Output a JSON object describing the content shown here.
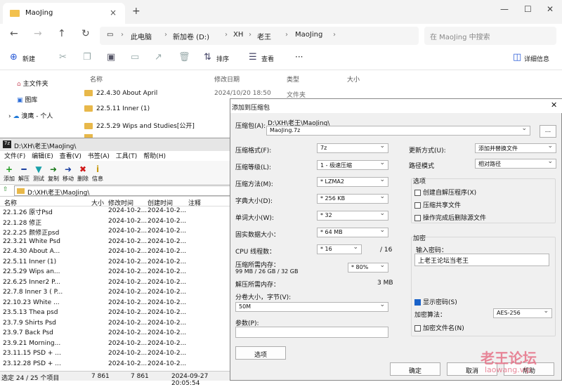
{
  "explorer": {
    "tab_title": "MaoJing",
    "breadcrumbs": [
      "此电脑",
      "新加卷 (D:)",
      "XH",
      "老王",
      "MaoJing"
    ],
    "search_placeholder": "在 MaoJing 中搜索",
    "toolbar": {
      "new": "新建",
      "sort": "排序",
      "view": "查看",
      "more": "···",
      "details": "详细信息"
    },
    "nav": [
      "主文件夹",
      "图库",
      "溴鹰 - 个人"
    ],
    "columns": {
      "name": "名称",
      "date": "修改日期",
      "type": "类型",
      "size": "大小"
    },
    "rows": [
      {
        "name": "22.4.30 About April",
        "date": "2024/10/20 18:50",
        "type": "文件夹"
      },
      {
        "name": "22.5.11 Inner (1)",
        "date": "",
        "type": ""
      },
      {
        "name": "22.5.29 Wips and Studies[公开]",
        "date": "",
        "type": ""
      }
    ]
  },
  "fm": {
    "title": "D:\\XH\\老王\\MaoJing\\",
    "menu": [
      "文件(F)",
      "编辑(E)",
      "查看(V)",
      "书签(A)",
      "工具(T)",
      "帮助(H)"
    ],
    "tools": [
      {
        "label": "添加",
        "icon": "+",
        "color": "#1c9a1c"
      },
      {
        "label": "解压",
        "icon": "━",
        "color": "#1a3fa0"
      },
      {
        "label": "测试",
        "icon": "▼",
        "color": "#18a0a8"
      },
      {
        "label": "复制",
        "icon": "➜",
        "color": "#1a7a1a"
      },
      {
        "label": "移动",
        "icon": "➜",
        "color": "#1a3fa0"
      },
      {
        "label": "删除",
        "icon": "✖",
        "color": "#d01818"
      },
      {
        "label": "信息",
        "icon": "i",
        "color": "#c89a10"
      }
    ],
    "path": "D:\\XH\\老王\\MaoJing\\",
    "columns": {
      "name": "名称",
      "size": "大小",
      "modified": "修改时间",
      "created": "创建时间",
      "comment": "注释"
    },
    "rows": [
      {
        "name": "22.1.26 原寸Psd",
        "modified": "2024-10-2...",
        "created": "2024-10-2..."
      },
      {
        "name": "22.1.28 修正",
        "modified": "2024-10-2...",
        "created": "2024-10-2..."
      },
      {
        "name": "22.2.25 颜修正psd",
        "modified": "2024-10-2...",
        "created": "2024-10-2..."
      },
      {
        "name": "22.3.21 White Psd",
        "modified": "2024-10-2...",
        "created": "2024-10-2..."
      },
      {
        "name": "22.4.30 About A...",
        "modified": "2024-10-2...",
        "created": "2024-10-2..."
      },
      {
        "name": "22.5.11 Inner (1)",
        "modified": "2024-10-2...",
        "created": "2024-10-2..."
      },
      {
        "name": "22.5.29 Wips an...",
        "modified": "2024-10-2...",
        "created": "2024-10-2..."
      },
      {
        "name": "22.6.25 Inner2 P...",
        "modified": "2024-10-2...",
        "created": "2024-10-2..."
      },
      {
        "name": "22.7.8 Inner 3 ( P...",
        "modified": "2024-10-2...",
        "created": "2024-10-2..."
      },
      {
        "name": "22.10.23 White ...",
        "modified": "2024-10-2...",
        "created": "2024-10-2..."
      },
      {
        "name": "23.5.13 Thea psd",
        "modified": "2024-10-2...",
        "created": "2024-10-2..."
      },
      {
        "name": "23.7.9 Shirts Psd",
        "modified": "2024-10-2...",
        "created": "2024-10-2..."
      },
      {
        "name": "23.9.7 Back Psd",
        "modified": "2024-10-2...",
        "created": "2024-10-2..."
      },
      {
        "name": "23.9.21 Morning...",
        "modified": "2024-10-2...",
        "created": "2024-10-2..."
      },
      {
        "name": "23.11.15 PSD + ...",
        "modified": "2024-10-2...",
        "created": "2024-10-2..."
      },
      {
        "name": "23.12.28 PSD + ...",
        "modified": "2024-10-2...",
        "created": "2024-10-2..."
      }
    ],
    "status": {
      "selected": "选定 24 / 25 个项目",
      "size1": "7 861",
      "size2": "7 861",
      "date": "2024-09-27 20:05:54"
    }
  },
  "dialog": {
    "title": "添加到压缩包",
    "archive_label": "压缩包(A):",
    "archive_dir": "D:\\XH\\老王\\MaoJing\\",
    "archive_name": "MaoJing.7z",
    "browse": "...",
    "format_label": "压缩格式(F):",
    "format": "7z",
    "level_label": "压缩等级(L):",
    "level": "1 - 极速压缩",
    "method_label": "压缩方法(M):",
    "method": "* LZMA2",
    "dict_label": "字典大小(D):",
    "dict": "* 256 KB",
    "word_label": "单词大小(W):",
    "word": "* 32",
    "solid_label": "固实数据大小：",
    "solid": "* 64 MB",
    "cpu_label": "CPU 线程数：",
    "cpu": "* 16",
    "cpu_total": "/ 16",
    "mem_comp_label": "压缩所需内存：",
    "mem_comp_detail": "99 MB / 26 GB / 32 GB",
    "mem_comp_pct": "* 80%",
    "mem_decomp_label": "解压所需内存：",
    "mem_decomp": "3 MB",
    "split_label": "分卷大小，字节(V):",
    "split": "50M",
    "params_label": "参数(P):",
    "options_btn": "选项",
    "update_label": "更新方式(U):",
    "update": "添加并替换文件",
    "pathmode_label": "路径模式",
    "pathmode": "相对路径",
    "options_title": "选项",
    "opt_sfx": "创建自解压程序(X)",
    "opt_shared": "压缩共享文件",
    "opt_delete": "操作完成后删除源文件",
    "encrypt_title": "加密",
    "password_label": "输入密码：",
    "password": "上老王论坛当老王",
    "show_pw": "显示密码(S)",
    "enc_method_label": "加密算法：",
    "enc_method": "AES-256",
    "enc_names": "加密文件名(N)",
    "ok": "确定",
    "cancel": "取消",
    "help": "帮助"
  },
  "watermark": {
    "line1": "老王论坛",
    "line2": "laowang.vip"
  }
}
